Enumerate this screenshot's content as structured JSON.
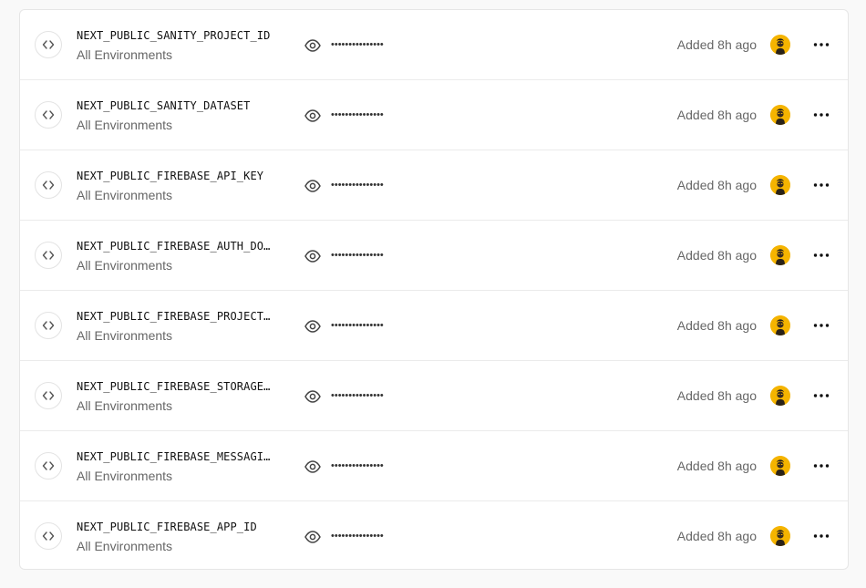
{
  "env_vars": [
    {
      "name": "NEXT_PUBLIC_SANITY_PROJECT_ID",
      "environment": "All Environments",
      "masked_value": "•••••••••••••••",
      "added": "Added 8h ago"
    },
    {
      "name": "NEXT_PUBLIC_SANITY_DATASET",
      "environment": "All Environments",
      "masked_value": "•••••••••••••••",
      "added": "Added 8h ago"
    },
    {
      "name": "NEXT_PUBLIC_FIREBASE_API_KEY",
      "environment": "All Environments",
      "masked_value": "•••••••••••••••",
      "added": "Added 8h ago"
    },
    {
      "name": "NEXT_PUBLIC_FIREBASE_AUTH_DO…",
      "environment": "All Environments",
      "masked_value": "•••••••••••••••",
      "added": "Added 8h ago"
    },
    {
      "name": "NEXT_PUBLIC_FIREBASE_PROJECT…",
      "environment": "All Environments",
      "masked_value": "•••••••••••••••",
      "added": "Added 8h ago"
    },
    {
      "name": "NEXT_PUBLIC_FIREBASE_STORAGE…",
      "environment": "All Environments",
      "masked_value": "•••••••••••••••",
      "added": "Added 8h ago"
    },
    {
      "name": "NEXT_PUBLIC_FIREBASE_MESSAGI…",
      "environment": "All Environments",
      "masked_value": "•••••••••••••••",
      "added": "Added 8h ago"
    },
    {
      "name": "NEXT_PUBLIC_FIREBASE_APP_ID",
      "environment": "All Environments",
      "masked_value": "•••••••••••••••",
      "added": "Added 8h ago"
    }
  ],
  "icons": {
    "type": "code-brackets-icon",
    "reveal": "eye-icon",
    "more": "ellipsis-icon",
    "avatar": "user-avatar"
  },
  "colors": {
    "avatar_bg": "#f5b400",
    "text_primary": "#111111",
    "text_secondary": "#666666",
    "border": "#ebebeb"
  }
}
